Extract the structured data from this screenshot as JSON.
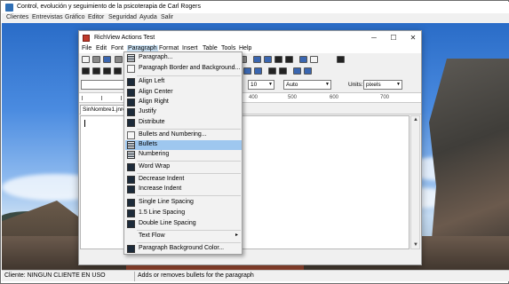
{
  "app": {
    "title": "Control, evolución y seguimiento de la psicoterapia de Carl Rogers",
    "menu": [
      "Clientes",
      "Entrevistas",
      "Gráfico",
      "Editor",
      "Seguridad",
      "Ayuda",
      "Salir"
    ]
  },
  "window": {
    "title": "RichView Actions Test",
    "controls": {
      "minimize": "─",
      "maximize": "☐",
      "close": "✕"
    },
    "menu": [
      "File",
      "Edit",
      "Font",
      "Paragraph",
      "Format",
      "Insert",
      "Table",
      "Tools",
      "Help"
    ],
    "toolbar": {
      "font_size": "10",
      "auto_value": "Auto",
      "units_label": "Units:",
      "units_value": "pixels"
    },
    "ruler_ticks": [
      "400",
      "500",
      "600",
      "700"
    ],
    "tab_label": "SinNombre1.jnre"
  },
  "paragraph_menu": {
    "items": [
      {
        "label": "Paragraph...",
        "icon": "paragraph-icon"
      },
      {
        "label": "Paragraph Border and Background...",
        "icon": "paragraph-border-icon"
      },
      {
        "label": "Align Left",
        "icon": "align-left-icon"
      },
      {
        "label": "Align Center",
        "icon": "align-center-icon"
      },
      {
        "label": "Align Right",
        "icon": "align-right-icon"
      },
      {
        "label": "Justify",
        "icon": "justify-icon"
      },
      {
        "label": "Distribute",
        "icon": "distribute-icon"
      },
      {
        "label": "Bullets and Numbering...",
        "icon": "bullets-numbering-icon"
      },
      {
        "label": "Bullets",
        "icon": "bullets-icon"
      },
      {
        "label": "Numbering",
        "icon": "numbering-icon"
      },
      {
        "label": "Word Wrap",
        "icon": "word-wrap-icon"
      },
      {
        "label": "Decrease Indent",
        "icon": "decrease-indent-icon"
      },
      {
        "label": "Increase Indent",
        "icon": "increase-indent-icon"
      },
      {
        "label": "Single Line Spacing",
        "icon": "single-spacing-icon"
      },
      {
        "label": "1.5 Line Spacing",
        "icon": "one-half-spacing-icon"
      },
      {
        "label": "Double Line Spacing",
        "icon": "double-spacing-icon"
      },
      {
        "label": "Text Flow",
        "icon": ""
      },
      {
        "label": "Paragraph Background Color...",
        "icon": "background-color-icon"
      }
    ],
    "highlighted": "Bullets",
    "submenu_arrow": "▸"
  },
  "status": {
    "client": "Cliente: NINGUN CLIENTE EN USO",
    "hint": "Adds or removes bullets for the paragraph"
  }
}
